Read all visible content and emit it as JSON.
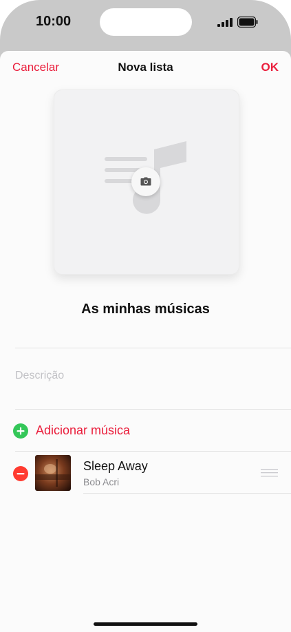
{
  "status_bar": {
    "time": "10:00"
  },
  "nav": {
    "cancel_label": "Cancelar",
    "title": "Nova lista",
    "ok_label": "OK"
  },
  "playlist": {
    "name": "As minhas músicas",
    "description_value": "",
    "description_placeholder": "Descrição"
  },
  "add_music": {
    "label": "Adicionar música"
  },
  "songs": [
    {
      "title": "Sleep Away",
      "artist": "Bob Acri"
    }
  ],
  "icons": {
    "camera": "camera-icon",
    "add": "plus-circle-icon",
    "remove": "minus-circle-icon",
    "drag": "reorder-handle-icon",
    "music_note": "music-note-icon"
  },
  "colors": {
    "accent": "#ea1d3b",
    "add_green": "#34c759",
    "remove_red": "#ff3b30"
  }
}
